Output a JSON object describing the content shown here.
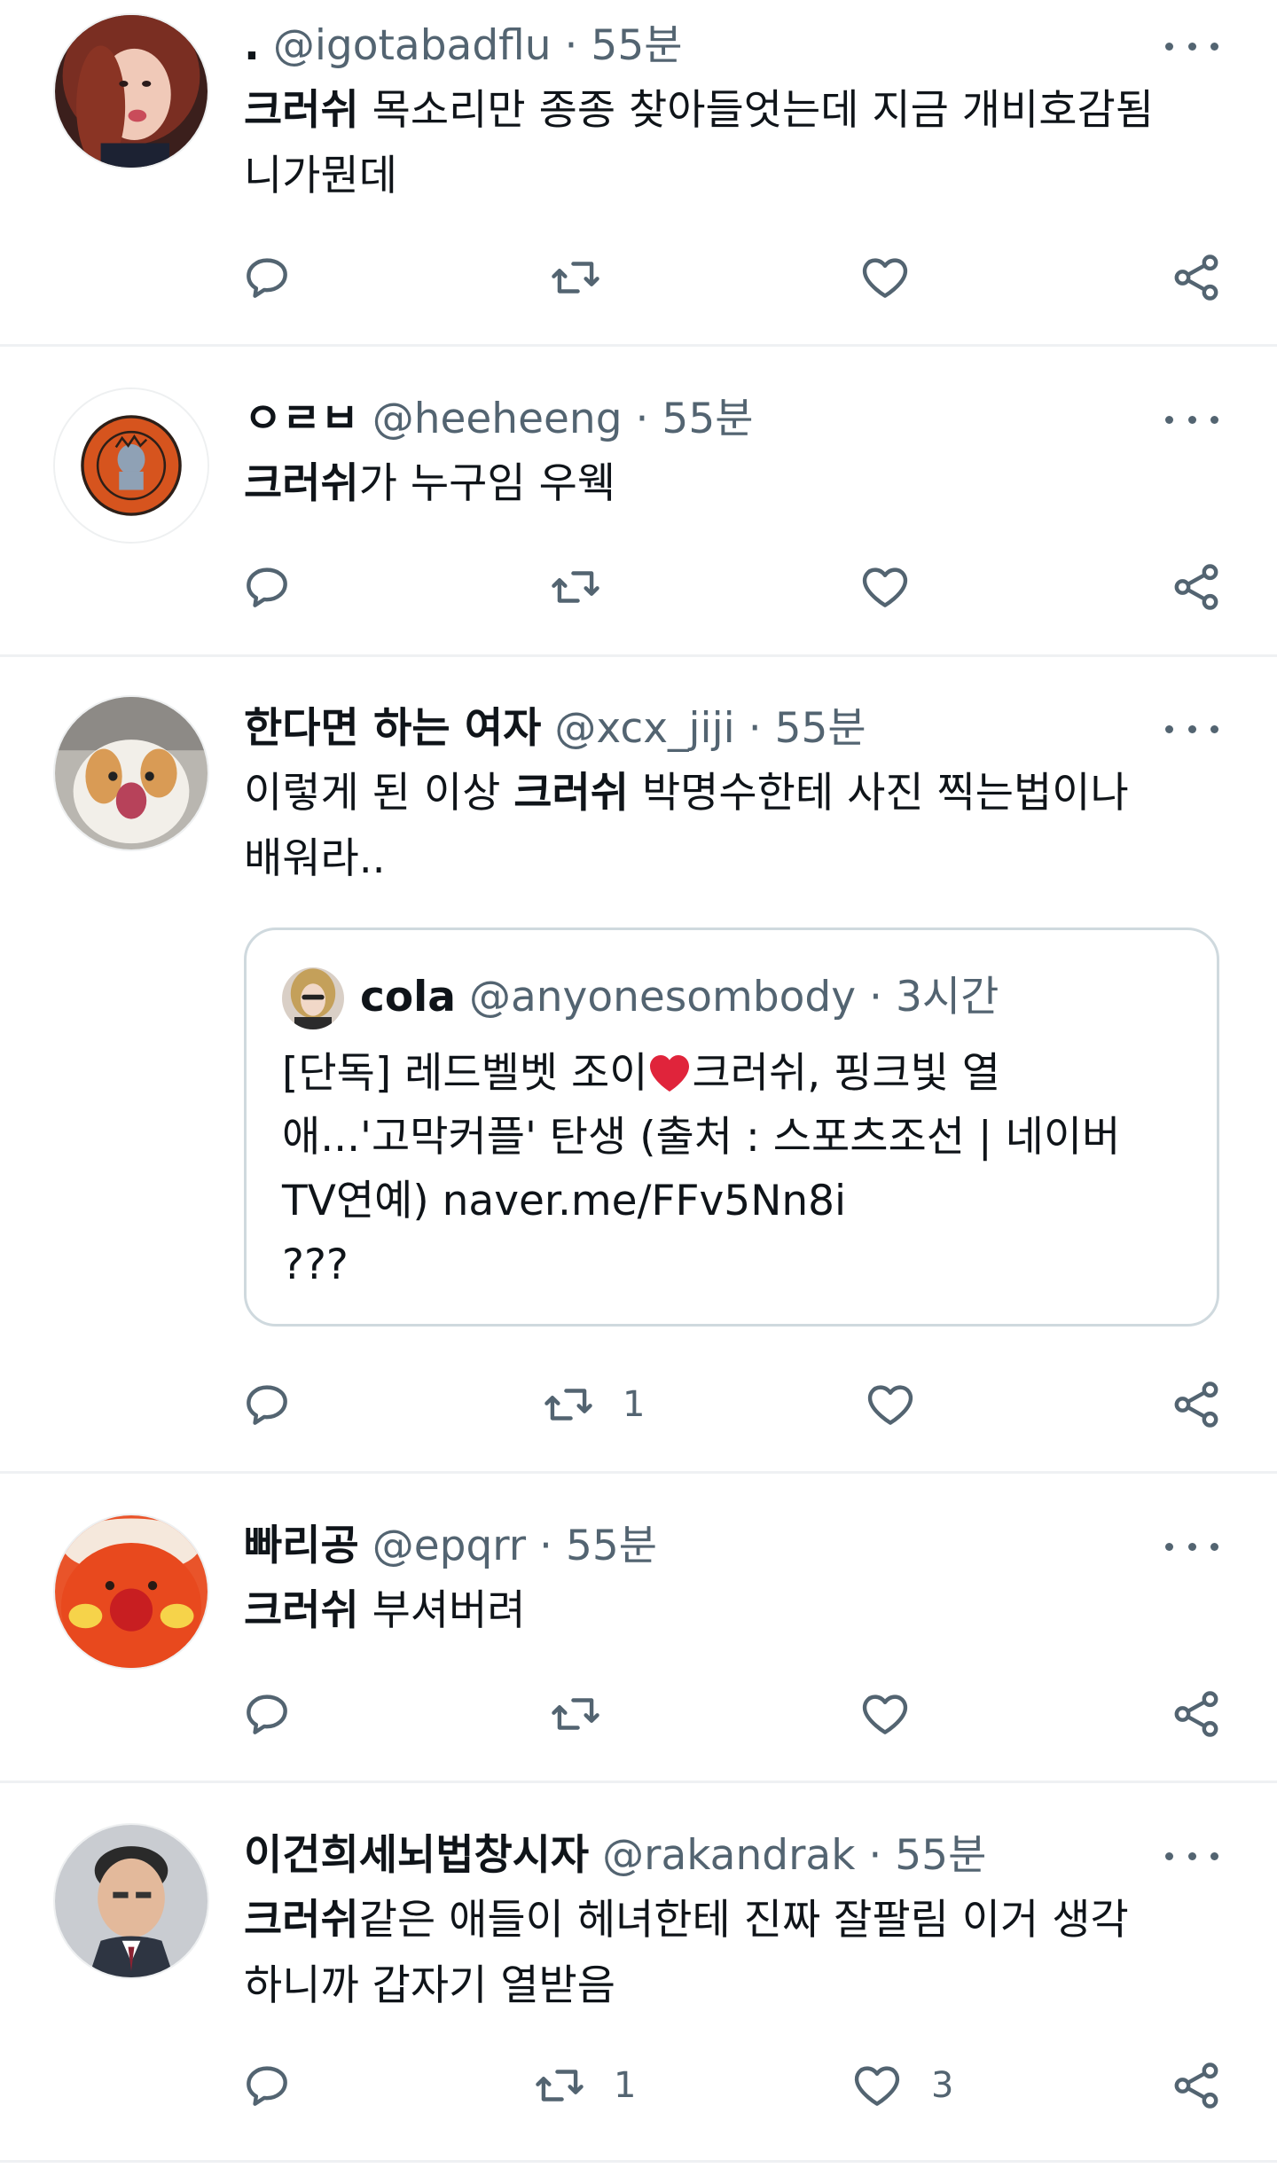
{
  "colors": {
    "secondary_text": "#536471",
    "primary_text": "#0f1419",
    "divider": "#eff1f3",
    "heart_emoji": "#e0243b"
  },
  "tweets": [
    {
      "display_name": ".",
      "handle": "@igotabadflu",
      "sep": "·",
      "time": "55분",
      "keyword": "크러쉬",
      "text_rest": " 목소리만 종종 찾아들엇는데 지금 개비호감됨\n니가뭔데",
      "retweet_count": "",
      "like_count": ""
    },
    {
      "display_name": "ㅇㄹㅂ",
      "handle": "@heeheeng",
      "sep": "·",
      "time": "55분",
      "keyword": "크러쉬",
      "text_rest": "가 누구임 우웩",
      "retweet_count": "",
      "like_count": ""
    },
    {
      "display_name": "한다면 하는 여자",
      "handle": "@xcx_jiji",
      "sep": "·",
      "time": "55분",
      "text_before": "이렇게 된 이상 ",
      "keyword": "크러쉬",
      "text_rest": " 박명수한테 사진 찍는법이나\n배워라..",
      "quote": {
        "display_name": "cola",
        "handle": "@anyonesombody",
        "sep": "·",
        "time": "3시간",
        "line1_a": "[단독] 레드벨벳 조이",
        "line1_b": "크러쉬, 핑크빛 열",
        "rest": "애...'고막커플' 탄생 (출처 : 스포츠조선 | 네이버\nTV연예) naver.me/FFv5Nn8i\n???"
      },
      "retweet_count": "1",
      "like_count": ""
    },
    {
      "display_name": "빠리공",
      "handle": "@epqrr",
      "sep": "·",
      "time": "55분",
      "keyword": "크러쉬",
      "text_rest": " 부셔버려",
      "retweet_count": "",
      "like_count": ""
    },
    {
      "display_name": "이건희세뇌법창시자",
      "handle": "@rakandrak",
      "sep": "·",
      "time": "55분",
      "keyword": "크러쉬",
      "text_rest": "같은 애들이 헤녀한테 진짜 잘팔림 이거 생각\n하니까 갑자기 열받음",
      "retweet_count": "1",
      "like_count": "3"
    }
  ],
  "icons": {
    "reply": "reply-icon",
    "retweet": "retweet-icon",
    "like": "heart-icon",
    "share": "share-icon",
    "more": "more-options-icon"
  }
}
